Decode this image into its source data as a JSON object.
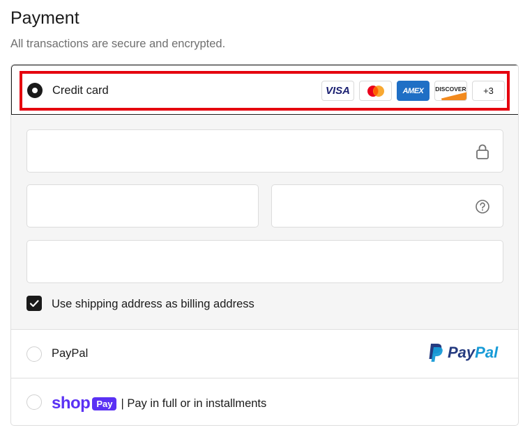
{
  "header": {
    "title": "Payment",
    "subtitle": "All transactions are secure and encrypted."
  },
  "credit_card": {
    "label": "Credit card",
    "selected": true,
    "cards": [
      {
        "name": "visa",
        "label": "VISA"
      },
      {
        "name": "mastercard",
        "label": ""
      },
      {
        "name": "amex",
        "label": "AMEX"
      },
      {
        "name": "discover",
        "label": "DISCOVER"
      },
      {
        "name": "more",
        "label": "+3"
      }
    ],
    "billing_checkbox": {
      "label": "Use shipping address as billing address",
      "checked": true
    }
  },
  "paypal": {
    "label": "PayPal",
    "logo_a": "Pay",
    "logo_b": "Pal",
    "selected": false
  },
  "shop_pay": {
    "logo_word": "shop",
    "logo_pill": "Pay",
    "tagline": "| Pay in full or in installments",
    "selected": false
  },
  "colors": {
    "highlight": "#e5000e",
    "shop_purple": "#5a31f4",
    "paypal_dark": "#253b80",
    "paypal_light": "#179bd7"
  },
  "icons": [
    "lock-icon",
    "help-circle-icon",
    "check-icon",
    "paypal-p-icon"
  ]
}
